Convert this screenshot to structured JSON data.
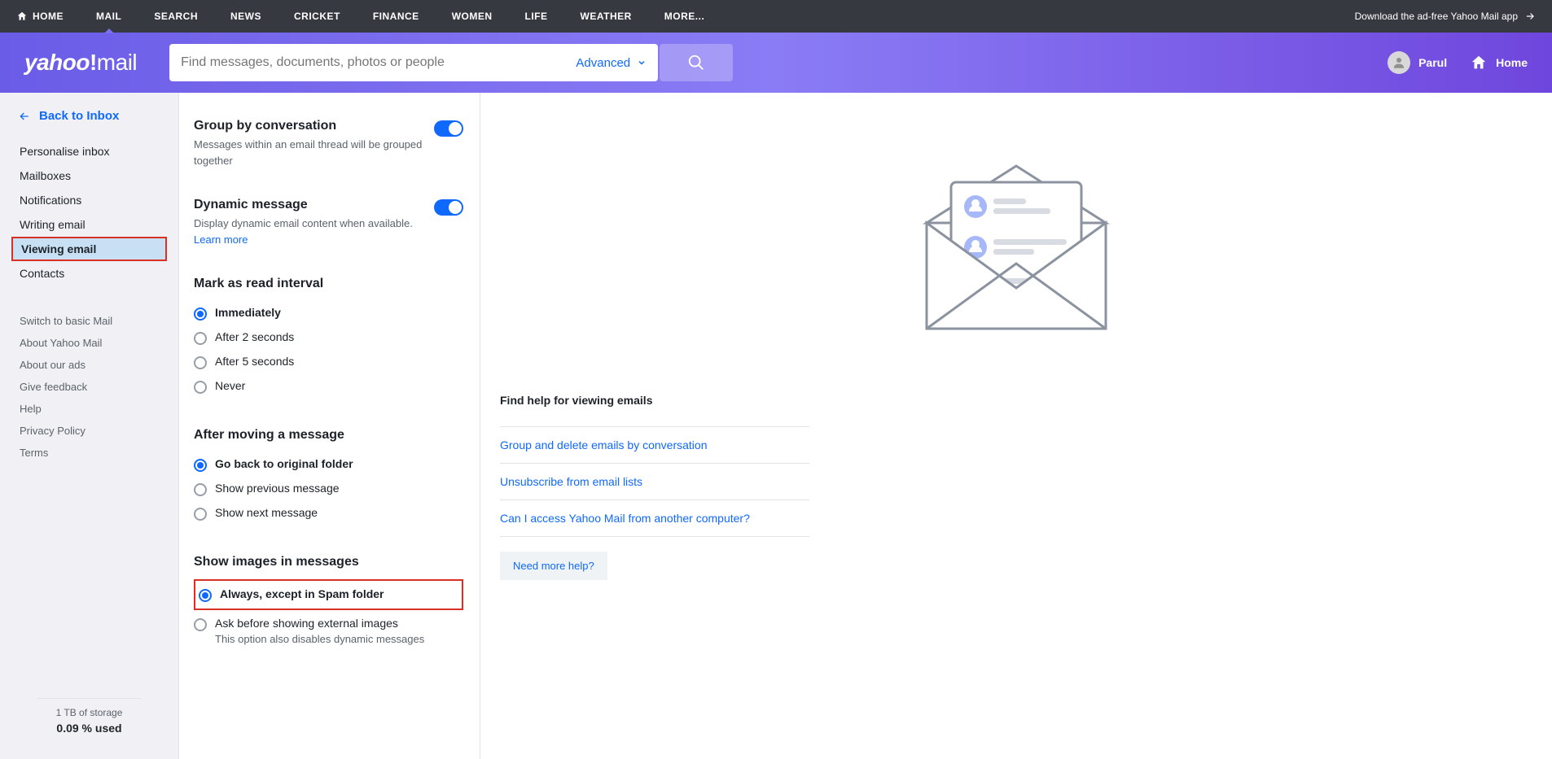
{
  "topnav": {
    "items": [
      "HOME",
      "MAIL",
      "SEARCH",
      "NEWS",
      "CRICKET",
      "FINANCE",
      "WOMEN",
      "LIFE",
      "WEATHER",
      "MORE..."
    ],
    "download": "Download the ad-free Yahoo Mail app"
  },
  "header": {
    "logo_pre": "yahoo",
    "logo_excl": "!",
    "logo_mail": "mail",
    "search_placeholder": "Find messages, documents, photos or people",
    "advanced": "Advanced",
    "user": "Parul",
    "home": "Home"
  },
  "sidebar": {
    "back": "Back to Inbox",
    "primary": [
      "Personalise inbox",
      "Mailboxes",
      "Notifications",
      "Writing email",
      "Viewing email",
      "Contacts"
    ],
    "secondary": [
      "Switch to basic Mail",
      "About Yahoo Mail",
      "About our ads",
      "Give feedback",
      "Help",
      "Privacy Policy",
      "Terms"
    ],
    "storage_line": "1 TB of storage",
    "storage_used": "0.09 % used"
  },
  "settings": {
    "group": {
      "title": "Group by conversation",
      "desc": "Messages within an email thread will be grouped together"
    },
    "dynamic": {
      "title": "Dynamic message",
      "desc": "Display dynamic email content when available. ",
      "learn": "Learn more"
    },
    "read": {
      "title": "Mark as read interval",
      "opts": [
        "Immediately",
        "After 2 seconds",
        "After 5 seconds",
        "Never"
      ]
    },
    "move": {
      "title": "After moving a message",
      "opts": [
        "Go back to original folder",
        "Show previous message",
        "Show next message"
      ]
    },
    "images": {
      "title": "Show images in messages",
      "opts": [
        "Always, except in Spam folder",
        "Ask before showing external images"
      ],
      "sub": "This option also disables dynamic messages"
    }
  },
  "help": {
    "title": "Find help for viewing emails",
    "links": [
      "Group and delete emails by conversation",
      "Unsubscribe from email lists",
      "Can I access Yahoo Mail from another computer?"
    ],
    "need": "Need more help?"
  }
}
